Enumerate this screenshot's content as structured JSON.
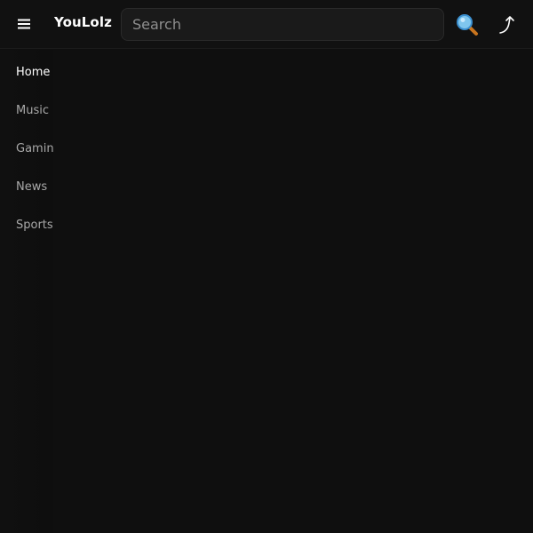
{
  "header": {
    "brand": "YouLolz",
    "search_placeholder": "Search",
    "search_value": ""
  },
  "icons": {
    "menu": "hamburger-menu-icon",
    "search": "magnifying-glass-icon",
    "share": "share-arrow-icon"
  },
  "sidebar": {
    "items": [
      {
        "label": "Home",
        "active": true
      },
      {
        "label": "Music",
        "active": false
      },
      {
        "label": "Gaming",
        "active": false
      },
      {
        "label": "News",
        "active": false
      },
      {
        "label": "Sports",
        "active": false
      }
    ]
  },
  "colors": {
    "background": "#0f0f0f",
    "topbar": "#111111",
    "search_bg": "#1a1a1a",
    "text_primary": "#ffffff",
    "text_secondary": "#a8a8a8"
  }
}
